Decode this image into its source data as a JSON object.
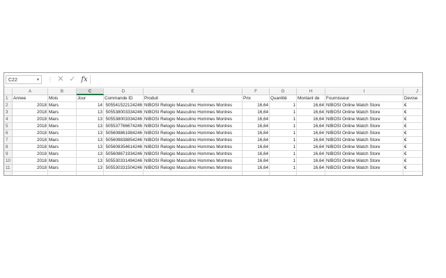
{
  "name_box": "C22",
  "formula_bar": {
    "cancel_icon": "✕",
    "enter_icon": "✓",
    "fx_label": "fx",
    "content": ""
  },
  "columns": [
    "A",
    "B",
    "C",
    "D",
    "E",
    "F",
    "G",
    "H",
    "I",
    "J"
  ],
  "selected_column": "C",
  "rows": [
    {
      "n": "1",
      "cells": [
        "Annee",
        "Mois",
        "Jour",
        "Commande ID",
        "Produit",
        "Prix",
        "Quantité",
        "Montant de",
        "Fournisseur",
        "Devise"
      ]
    },
    {
      "n": "2",
      "cells": [
        "2018",
        "Mars",
        "14",
        "505541522124246",
        "NIBOSI Relogio Masculino Hommes Montres",
        "16,64",
        "1",
        "16,64",
        "NIBOSI Online Watch Store",
        "€"
      ]
    },
    {
      "n": "3",
      "cells": [
        "2018",
        "Mars",
        "13",
        "505538003334246",
        "NIBOSI Relogio Masculino Hommes Montres",
        "16,64",
        "1",
        "16,64",
        "NIBOSI Online Watch Store",
        "€"
      ]
    },
    {
      "n": "4",
      "cells": [
        "2018",
        "Mars",
        "13",
        "505538003334246",
        "NIBOSI Relogio Masculino Hommes Montres",
        "16,64",
        "1",
        "16,64",
        "NIBOSI Online Watch Store",
        "€"
      ]
    },
    {
      "n": "5",
      "cells": [
        "2018",
        "Mars",
        "13",
        "505537766674246",
        "NIBOSI Relogio Masculino Hommes Montres",
        "16,64",
        "1",
        "16,64",
        "NIBOSI Online Watch Store",
        "€"
      ]
    },
    {
      "n": "6",
      "cells": [
        "2018",
        "Mars",
        "13",
        "505608861984246",
        "NIBOSI Relogio Masculino Hommes Montres",
        "16,64",
        "1",
        "16,64",
        "NIBOSI Online Watch Store",
        "€"
      ]
    },
    {
      "n": "7",
      "cells": [
        "2018",
        "Mars",
        "13",
        "505608838854246",
        "NIBOSI Relogio Masculino Hommes Montres",
        "16,64",
        "1",
        "16,64",
        "NIBOSI Online Watch Store",
        "€"
      ]
    },
    {
      "n": "8",
      "cells": [
        "2018",
        "Mars",
        "13",
        "505608354614246",
        "NIBOSI Relogio Masculino Hommes Montres",
        "16,64",
        "1",
        "16,64",
        "NIBOSI Online Watch Store",
        "€"
      ]
    },
    {
      "n": "9",
      "cells": [
        "2018",
        "Mars",
        "13",
        "505608671934246",
        "NIBOSI Relogio Masculino Hommes Montres",
        "16,64",
        "1",
        "16,64",
        "NIBOSI Online Watch Store",
        "€"
      ]
    },
    {
      "n": "10",
      "cells": [
        "2018",
        "Mars",
        "13",
        "505530331494246",
        "NIBOSI Relogio Masculino Hommes Montres",
        "16,64",
        "1",
        "16,64",
        "NIBOSI Online Watch Store",
        "€"
      ]
    },
    {
      "n": "11",
      "cells": [
        "2018",
        "Mars",
        "13",
        "505530331504246",
        "NIBOSI Relogio Masculino Hommes Montres",
        "16,64",
        "1",
        "16,64",
        "NIBOSI Online Watch Store",
        "€"
      ]
    }
  ],
  "colors": {
    "selected_header": "#217346",
    "gridline": "#dadada",
    "header_bg": "#f3f3f3"
  }
}
